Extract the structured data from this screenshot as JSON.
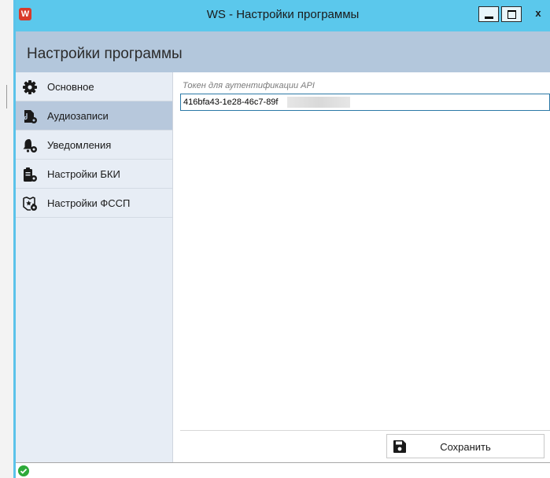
{
  "window": {
    "title": "WS - Настройки программы",
    "app_icon_letter": "W",
    "close_glyph": "x"
  },
  "header": {
    "title": "Настройки программы"
  },
  "sidebar": {
    "items": [
      {
        "label": "Основное",
        "icon": "gear-icon",
        "selected": false
      },
      {
        "label": "Аудиозаписи",
        "icon": "audio-file-settings-icon",
        "selected": true
      },
      {
        "label": "Уведомления",
        "icon": "bell-settings-icon",
        "selected": false
      },
      {
        "label": "Настройки БКИ",
        "icon": "clipboard-settings-icon",
        "selected": false
      },
      {
        "label": "Настройки ФССП",
        "icon": "badge-settings-icon",
        "selected": false
      }
    ]
  },
  "content": {
    "token_label": "Токен для аутентификации API",
    "token_value": "416bfa43-1e28-46c7-89f"
  },
  "footer": {
    "save_label": "Сохранить",
    "save_icon": "floppy-disk-icon"
  },
  "status": {
    "icon": "check-circle-icon",
    "color": "#2eaa3a"
  },
  "colors": {
    "titlebar": "#5bc8ec",
    "header": "#b3c7dc",
    "sidebar": "#e7edf5",
    "selected": "#b7c8dc"
  }
}
